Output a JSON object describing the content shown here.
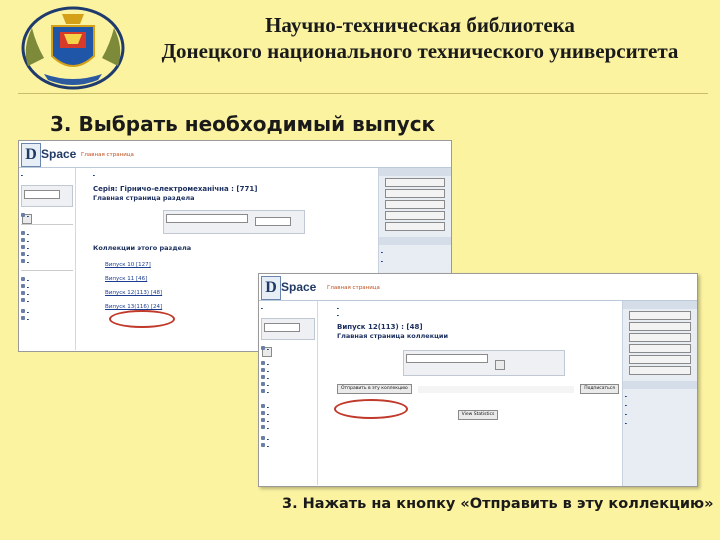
{
  "header": {
    "line1": "Научно-техническая библиотека",
    "line2": "Донецкого национального технического университета"
  },
  "steps": {
    "step1": "3. Выбрать необходимый выпуск",
    "step3": "3. Нажать на кнопку «Отправить в эту коллекцию»"
  },
  "shot1": {
    "logo_d": "D",
    "logo_rest": "Space",
    "home_link": "Главная страница",
    "collection_title": "Серія: Гірничо-електромеханічна : [771]",
    "subtitle": "Главная страница раздела",
    "section_collections": "Коллекции этого раздела",
    "issues": [
      "Випуск 10 [127]",
      "Випуск 11 [46]",
      "Випуск 12(113) [48]",
      "Випуск 13(116) [24]"
    ]
  },
  "shot2": {
    "logo_d": "D",
    "logo_rest": "Space",
    "home_link": "Главная страница",
    "collection_title": "Випуск 12(113) : [48]",
    "subtitle": "Главная страница коллекции",
    "submit_button": "Отправить в эту коллекцию",
    "go_button": "Перейти",
    "subscribe_button": "Подписаться",
    "view_stats_button": "View Statistics"
  }
}
